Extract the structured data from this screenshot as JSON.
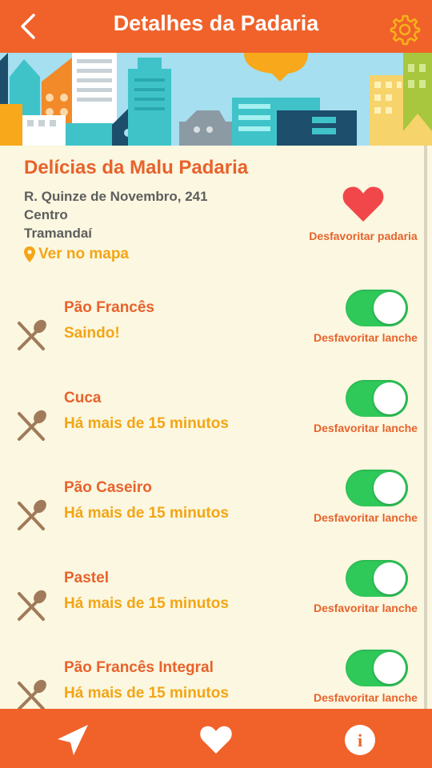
{
  "header": {
    "title": "Detalhes da Padaria",
    "back_icon": "chevron-left-icon",
    "settings_icon": "gear-icon",
    "accent_color": "#f0622a"
  },
  "bakery": {
    "name": "Delícias da Malu Padaria",
    "address_lines": [
      "R. Quinze de Novembro, 241",
      "Centro",
      "Tramandaí"
    ],
    "map_link": "Ver no mapa",
    "favorite_label": "Desfavoritar padaria",
    "favorite_icon": "heart-icon"
  },
  "products": [
    {
      "name": "Pão Francês",
      "status": "Saindo!",
      "toggle_on": true,
      "unfavorite_label": "Desfavoritar lanche"
    },
    {
      "name": "Cuca",
      "status": "Há mais de 15 minutos",
      "toggle_on": true,
      "unfavorite_label": "Desfavoritar lanche"
    },
    {
      "name": "Pão Caseiro",
      "status": "Há mais de 15 minutos",
      "toggle_on": true,
      "unfavorite_label": "Desfavoritar lanche"
    },
    {
      "name": "Pastel",
      "status": "Há mais de 15 minutos",
      "toggle_on": true,
      "unfavorite_label": "Desfavoritar lanche"
    },
    {
      "name": "Pão Francês Integral",
      "status": "Há mais de 15 minutos",
      "toggle_on": true,
      "unfavorite_label": "Desfavoritar lanche"
    }
  ],
  "bottom_nav": {
    "items": [
      "navigation-arrow-icon",
      "heart-icon",
      "info-icon"
    ]
  }
}
